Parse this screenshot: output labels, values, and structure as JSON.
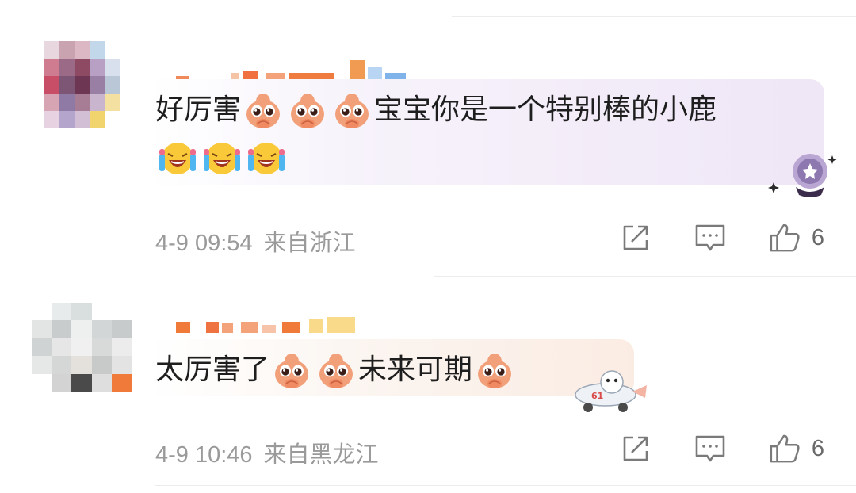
{
  "colors": {
    "meta_text": "#9a9a9a",
    "body_text": "#1e1e1e",
    "icon_stroke": "#7a7a7a"
  },
  "comments": [
    {
      "text_part1": "好厉害",
      "text_part2": "宝宝你是一个特别棒的小鹿",
      "emoji_line1": [
        "pleading-face-emoji",
        "pleading-face-emoji",
        "pleading-face-emoji"
      ],
      "emoji_line2": [
        "laughing-tears-emoji",
        "laughing-tears-emoji",
        "laughing-tears-emoji"
      ],
      "date": "4-9 09:54",
      "location": "来自浙江",
      "likes": "6"
    },
    {
      "text_part1": "太厉害了",
      "text_part2": "未来可期",
      "emoji": [
        "pleading-face-emoji",
        "pleading-face-emoji",
        "pleading-face-emoji"
      ],
      "date": "4-9 10:46",
      "location": "来自黑龙江",
      "likes": "6"
    }
  ]
}
